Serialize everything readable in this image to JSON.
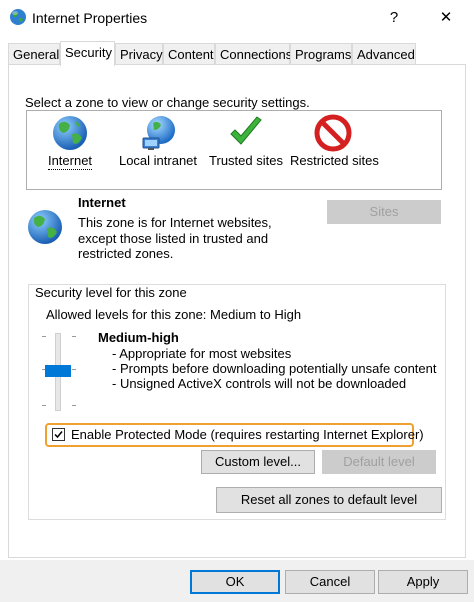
{
  "window": {
    "title": "Internet Properties",
    "help_label": "?",
    "close_label": "✕"
  },
  "tabs": [
    {
      "label": "General"
    },
    {
      "label": "Security"
    },
    {
      "label": "Privacy"
    },
    {
      "label": "Content"
    },
    {
      "label": "Connections"
    },
    {
      "label": "Programs"
    },
    {
      "label": "Advanced"
    }
  ],
  "zone_prompt": "Select a zone to view or change security settings.",
  "zones": [
    {
      "label": "Internet",
      "icon": "globe-icon"
    },
    {
      "label": "Local intranet",
      "icon": "network-globe-icon"
    },
    {
      "label": "Trusted sites",
      "icon": "checkmark-icon"
    },
    {
      "label": "Restricted sites",
      "icon": "no-entry-icon"
    }
  ],
  "selected_zone": {
    "name": "Internet",
    "description_lines": [
      "This zone is for Internet websites,",
      "except those listed in trusted and",
      "restricted zones."
    ],
    "sites_button": "Sites"
  },
  "security_level": {
    "group_title": "Security level for this zone",
    "allowed_levels": "Allowed levels for this zone: Medium to High",
    "level_name": "Medium-high",
    "bullets": [
      "- Appropriate for most websites",
      "- Prompts before downloading potentially unsafe content",
      "- Unsigned ActiveX controls will not be downloaded"
    ],
    "protected_mode_label": "Enable Protected Mode (requires restarting Internet Explorer)",
    "protected_mode_checked": true,
    "custom_level_button": "Custom level...",
    "default_level_button": "Default level"
  },
  "reset_button": "Reset all zones to default level",
  "footer": {
    "ok": "OK",
    "cancel": "Cancel",
    "apply": "Apply"
  },
  "colors": {
    "highlight_border": "#f0a030",
    "slider_thumb": "#0078d7",
    "ok_border": "#0078d7"
  }
}
